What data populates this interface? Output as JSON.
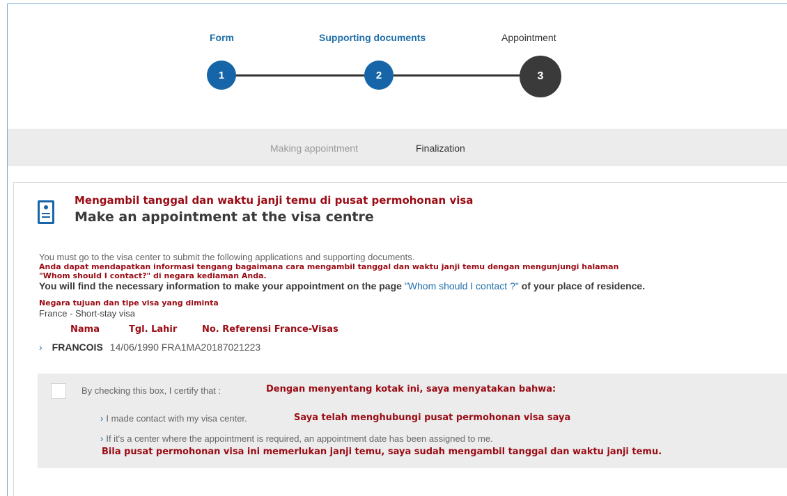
{
  "stepper": {
    "steps": [
      {
        "label": "Form",
        "number": "1",
        "state": "done"
      },
      {
        "label": "Supporting documents",
        "number": "2",
        "state": "done"
      },
      {
        "label": "Appointment",
        "number": "3",
        "state": "current"
      }
    ]
  },
  "subnav": {
    "items": [
      {
        "label": "Making appointment",
        "state": "inactive"
      },
      {
        "label": "Finalization",
        "state": "active"
      }
    ]
  },
  "card": {
    "icon": "document-person-icon",
    "title_id": "Mengambil tanggal dan waktu janji temu di pusat permohonan visa",
    "title_en": "Make an appointment at the visa centre",
    "intro": "You must go to the visa center to submit the following applications and supporting documents.",
    "note_id_1": "Anda dapat mendapatkan informasi tengang bagaimana cara mengambil tanggal dan waktu janji temu dengan mengunjungi halaman",
    "note_id_2": "\"Whom should I contact?\" di negara kediaman Anda.",
    "info_prefix": "You will find the necessary information to make your appointment on the page ",
    "info_link": "\"Whom should I contact ?\"",
    "info_suffix": " of your place of residence.",
    "dest_label_id": "Negara tujuan dan tipe visa yang diminta",
    "destination": "France - Short-stay visa",
    "columns": {
      "name": "Nama",
      "dob": "Tgl. Lahir",
      "ref": "No. Referensi France-Visas"
    },
    "applicant": {
      "name": "FRANCOIS",
      "dob": "14/06/1990",
      "ref": "FRA1MA20187021223"
    }
  },
  "certify": {
    "lead": "By checking this box, I certify that :",
    "lead_id": "Dengan menyentang kotak ini, saya menyatakan bahwa:",
    "item1": "I made contact with my visa center.",
    "item1_id": "Saya telah menghubungi pusat permohonan visa saya",
    "item2": "If it's a center where the appointment is required, an appointment date has been assigned to me.",
    "item2_id": "Bila pusat permohonan visa ini memerlukan janji temu, saya sudah mengambil tanggal dan waktu janji temu.",
    "checked": false
  },
  "colors": {
    "primary_blue": "#1565a8",
    "annotation_red": "#9a0b14",
    "current_step": "#3a3a3a"
  }
}
